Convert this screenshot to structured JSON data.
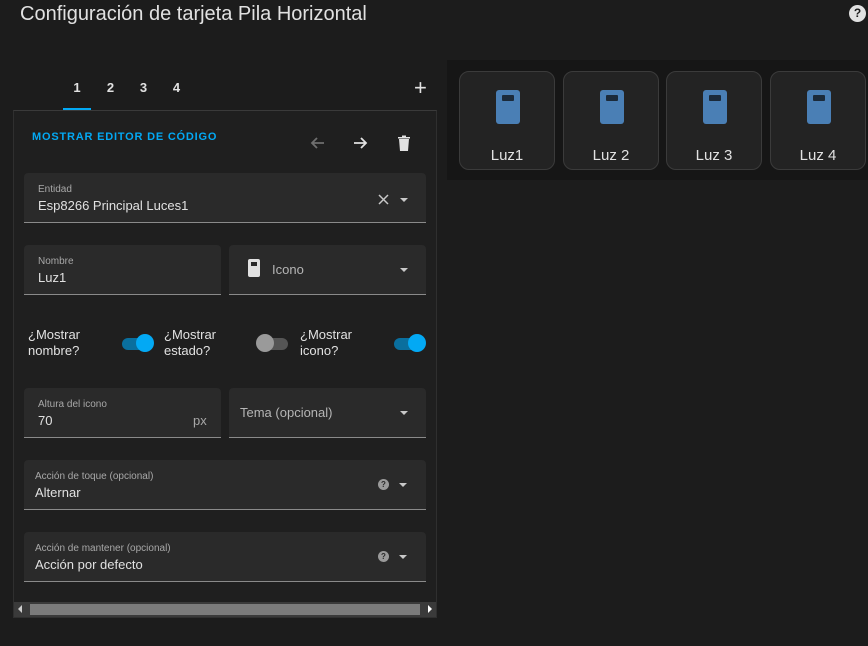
{
  "header": {
    "title": "Configuración de tarjeta Pila Horizontal",
    "help_icon": "help-circle-icon"
  },
  "tabs": [
    {
      "label": "1"
    },
    {
      "label": "2"
    },
    {
      "label": "3"
    },
    {
      "label": "4"
    }
  ],
  "add_tab_label": "+",
  "editor": {
    "show_code_label": "MOSTRAR EDITOR DE CÓDIGO",
    "tools": [
      "arrow-left-icon",
      "arrow-right-icon",
      "delete-icon"
    ],
    "entity": {
      "label": "Entidad",
      "value": "Esp8266 Principal Luces1"
    },
    "name": {
      "label": "Nombre",
      "value": "Luz1"
    },
    "icon": {
      "placeholder": "Icono",
      "icon": "light-switch-icon"
    },
    "toggles": [
      {
        "label_line1": "¿Mostrar",
        "label_line2": "nombre?",
        "on": true
      },
      {
        "label_line1": "¿Mostrar",
        "label_line2": "estado?",
        "on": false
      },
      {
        "label_line1": "¿Mostrar",
        "label_line2": "icono?",
        "on": true
      }
    ],
    "icon_height": {
      "label": "Altura del icono",
      "value": "70",
      "suffix": "px"
    },
    "theme": {
      "placeholder": "Tema (opcional)"
    },
    "tap_action": {
      "label": "Acción de toque (opcional)",
      "value": "Alternar"
    },
    "hold_action": {
      "label": "Acción de mantener (opcional)",
      "value": "Acción por defecto"
    }
  },
  "preview": {
    "cards": [
      {
        "label": "Luz1"
      },
      {
        "label": "Luz 2"
      },
      {
        "label": "Luz 3"
      },
      {
        "label": "Luz 4"
      }
    ],
    "icon_color": "#4a7fb5"
  },
  "colors": {
    "accent": "#03a9f4",
    "background": "#1c1c1c"
  }
}
